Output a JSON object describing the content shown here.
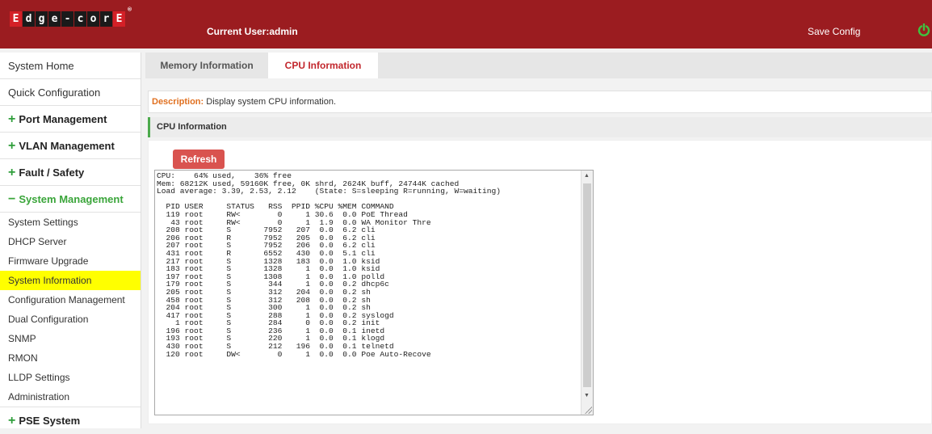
{
  "header": {
    "logo_letters": [
      "E",
      "d",
      "g",
      "e",
      "-",
      "c",
      "o",
      "r",
      "E"
    ],
    "registered": "®",
    "current_user": "Current User:admin",
    "save_config": "Save Config",
    "accent_color": "#9b1c20"
  },
  "sidebar": {
    "items": [
      {
        "label": "System Home"
      },
      {
        "label": "Quick Configuration"
      },
      {
        "label": "Port Management",
        "prefix": "+"
      },
      {
        "label": "VLAN Management",
        "prefix": "+"
      },
      {
        "label": "Fault / Safety",
        "prefix": "+"
      },
      {
        "label": "System Management",
        "prefix": "−"
      }
    ],
    "sub_items": [
      "System Settings",
      "DHCP Server",
      "Firmware Upgrade",
      "System Information",
      "Configuration Management",
      "Dual Configuration",
      "SNMP",
      "RMON",
      "LLDP Settings",
      "Administration"
    ],
    "last_group": {
      "label": "PSE System",
      "prefix": "+"
    }
  },
  "tabs": [
    "Memory Information",
    "CPU Information"
  ],
  "description": {
    "label": "Description:",
    "text": " Display system CPU information."
  },
  "section_title": "CPU Information",
  "refresh_label": "Refresh",
  "console_text": "CPU:    64% used,    36% free\nMem: 68212K used, 59160K free, 0K shrd, 2624K buff, 24744K cached\nLoad average: 3.39, 2.53, 2.12    (State: S=sleeping R=running, W=waiting)\n\n  PID USER     STATUS   RSS  PPID %CPU %MEM COMMAND\n  119 root     RW<        0     1 30.6  0.0 PoE Thread\n   43 root     RW<        0     1  1.9  0.0 WA Monitor Thre\n  208 root     S       7952   207  0.0  6.2 cli\n  206 root     R       7952   205  0.0  6.2 cli\n  207 root     S       7952   206  0.0  6.2 cli\n  431 root     R       6552   430  0.0  5.1 cli\n  217 root     S       1328   183  0.0  1.0 ksid\n  183 root     S       1328     1  0.0  1.0 ksid\n  197 root     S       1308     1  0.0  1.0 polld\n  179 root     S        344     1  0.0  0.2 dhcp6c\n  205 root     S        312   204  0.0  0.2 sh\n  458 root     S        312   208  0.0  0.2 sh\n  204 root     S        300     1  0.0  0.2 sh\n  417 root     S        288     1  0.0  0.2 syslogd\n    1 root     S        284     0  0.0  0.2 init\n  196 root     S        236     1  0.0  0.1 inetd\n  193 root     S        220     1  0.0  0.1 klogd\n  430 root     S        212   196  0.0  0.1 telnetd\n  120 root     DW<        0     1  0.0  0.0 Poe Auto-Recove"
}
